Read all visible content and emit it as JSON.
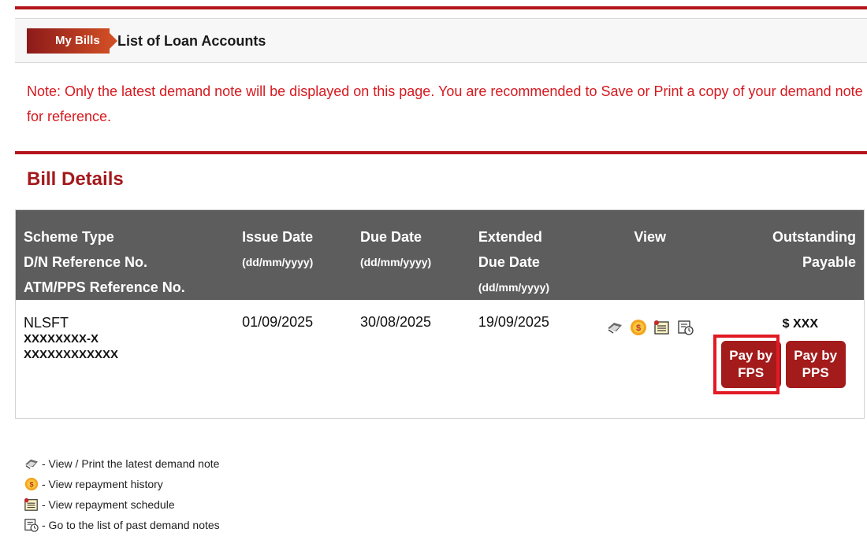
{
  "breadcrumb": {
    "home_label": "My Bills",
    "current_label": "List of Loan Accounts"
  },
  "note": "Note: Only the latest demand note will be displayed on this page. You are recommended to Save or Print a copy of your demand note for reference.",
  "section_title": "Bill Details",
  "table": {
    "headers": {
      "scheme": [
        "Scheme Type",
        "D/N Reference No.",
        "ATM/PPS Reference No."
      ],
      "issue": [
        "Issue Date",
        "(dd/mm/yyyy)"
      ],
      "due": [
        "Due Date",
        "(dd/mm/yyyy)"
      ],
      "extended": [
        "Extended",
        "Due Date",
        "(dd/mm/yyyy)"
      ],
      "view": "View",
      "outstanding": [
        "Outstanding",
        "Payable"
      ]
    },
    "row": {
      "scheme_type": "NLSFT",
      "dn_ref": "XXXXXXXX-X",
      "atm_pps_ref": "XXXXXXXXXXXX",
      "issue_date": "01/09/2025",
      "due_date": "30/08/2025",
      "extended_due_date": "19/09/2025",
      "outstanding": "$ XXX",
      "pay_fps_line1": "Pay by",
      "pay_fps_line2": "FPS",
      "pay_pps_line1": "Pay by",
      "pay_pps_line2": "PPS"
    }
  },
  "legend": [
    {
      "icon": "print-note-icon",
      "text": "- View / Print the latest demand note"
    },
    {
      "icon": "repayment-history-icon",
      "text": "- View repayment history"
    },
    {
      "icon": "repayment-schedule-icon",
      "text": "- View repayment schedule"
    },
    {
      "icon": "past-notes-icon",
      "text": "- Go to the list of past demand notes"
    }
  ],
  "colors": {
    "accent_red": "#b3141c",
    "note_red": "#d6191f",
    "header_gray": "#5d5d5d",
    "button_red": "#a31b1b",
    "highlight_red": "#e21a24"
  }
}
